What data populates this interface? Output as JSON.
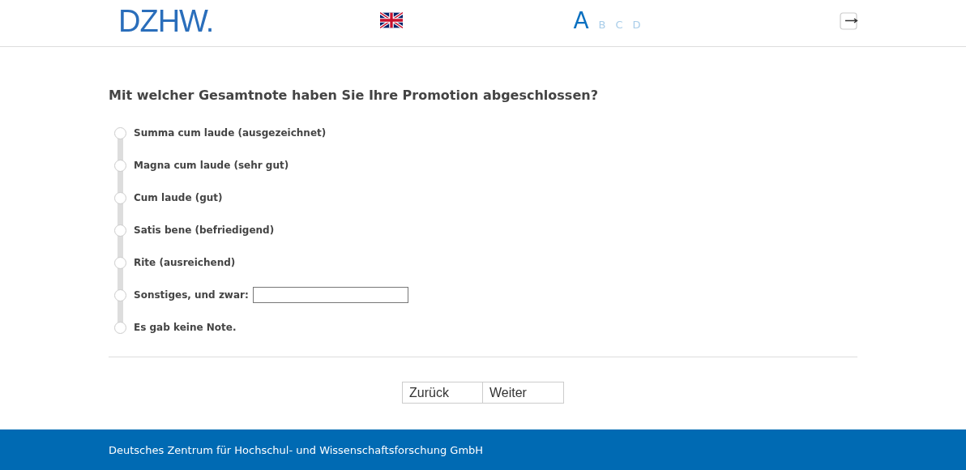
{
  "header": {
    "logo": "DZHW.",
    "pages": [
      {
        "label": "A",
        "selected": true
      },
      {
        "label": "B",
        "selected": false
      },
      {
        "label": "C",
        "selected": false
      },
      {
        "label": "D",
        "selected": false
      }
    ]
  },
  "question": "Mit welcher Gesamtnote haben Sie Ihre Promotion abgeschlossen?",
  "options": [
    {
      "kind": "plain",
      "label": "Summa cum laude (ausgezeichnet)",
      "selected": false
    },
    {
      "kind": "plain",
      "label": "Magna cum laude (sehr gut)",
      "selected": false
    },
    {
      "kind": "plain",
      "label": "Cum laude (gut)",
      "selected": false
    },
    {
      "kind": "plain",
      "label": "Satis bene (befriedigend)",
      "selected": false
    },
    {
      "kind": "plain",
      "label": "Rite (ausreichend)",
      "selected": false
    },
    {
      "kind": "with_text",
      "label": "Sonstiges, und zwar:",
      "selected": false
    },
    {
      "kind": "plain",
      "label": "Es gab keine Note.",
      "selected": false
    }
  ],
  "buttons": [
    "Zurück",
    "Weiter"
  ],
  "footer": "Deutsches Zentrum für Hochschul- und Wissenschaftsforschung GmbH"
}
